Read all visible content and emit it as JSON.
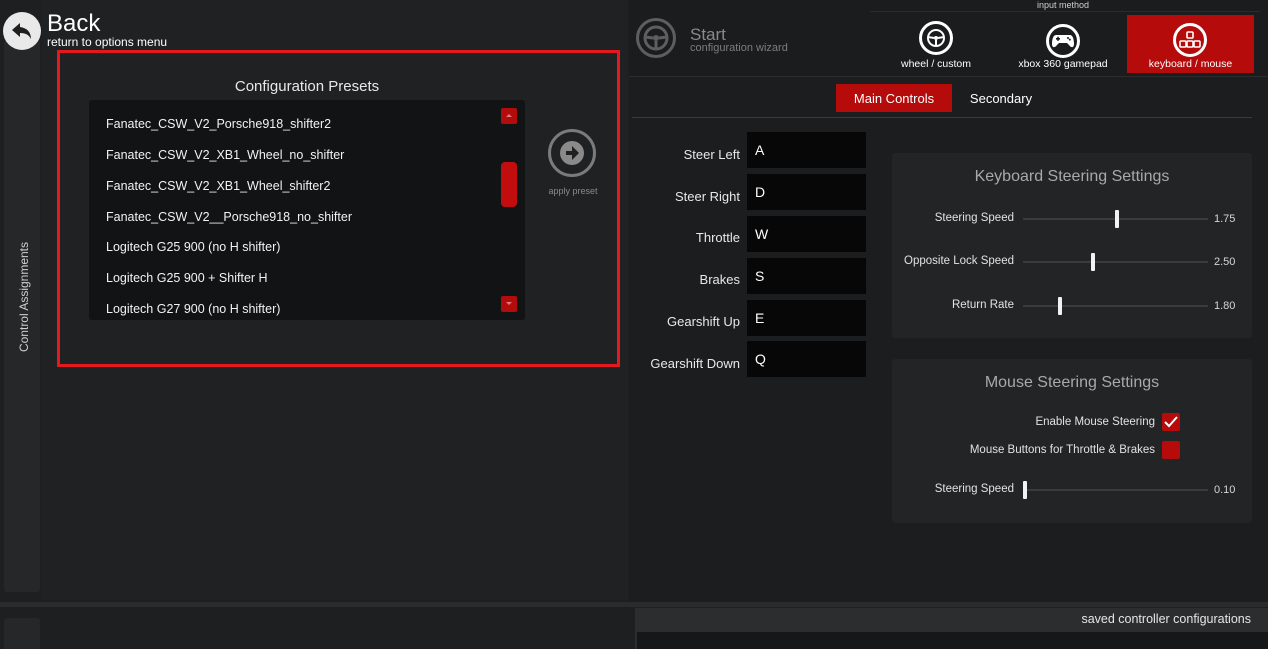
{
  "back": {
    "title": "Back",
    "subtitle": "return to options menu"
  },
  "side_strip": {
    "label": "Control Assignments"
  },
  "presets": {
    "title": "Configuration Presets",
    "items": [
      "Fanatec_CSW_V2_Porsche918_shifter2",
      "Fanatec_CSW_V2_XB1_Wheel_no_shifter",
      "Fanatec_CSW_V2_XB1_Wheel_shifter2",
      "Fanatec_CSW_V2__Porsche918_no_shifter",
      "Logitech G25 900 (no H shifter)",
      "Logitech G25 900 + Shifter H",
      "Logitech G27 900 (no H shifter)"
    ],
    "apply_label": "apply preset"
  },
  "wizard": {
    "title": "Start",
    "subtitle": "configuration wizard"
  },
  "input_method": {
    "label": "input method",
    "options": [
      {
        "label": "wheel / custom",
        "icon": "steering-wheel-icon",
        "selected": false
      },
      {
        "label": "xbox 360 gamepad",
        "icon": "gamepad-icon",
        "selected": false
      },
      {
        "label": "keyboard / mouse",
        "icon": "keyboard-icon",
        "selected": true
      }
    ]
  },
  "tabs": {
    "main": "Main Controls",
    "secondary": "Secondary"
  },
  "bindings": [
    {
      "label": "Steer Left",
      "key": "A"
    },
    {
      "label": "Steer Right",
      "key": "D"
    },
    {
      "label": "Throttle",
      "key": "W"
    },
    {
      "label": "Brakes",
      "key": "S"
    },
    {
      "label": "Gearshift Up",
      "key": "E"
    },
    {
      "label": "Gearshift Down",
      "key": "Q"
    }
  ],
  "keyboard_settings": {
    "title": "Keyboard Steering Settings",
    "sliders": [
      {
        "label": "Steering Speed",
        "value": "1.75",
        "fill": 0.51
      },
      {
        "label": "Opposite Lock Speed",
        "value": "2.50",
        "fill": 0.38
      },
      {
        "label": "Return Rate",
        "value": "1.80",
        "fill": 0.2
      }
    ]
  },
  "mouse_settings": {
    "title": "Mouse Steering Settings",
    "enable_label": "Enable Mouse Steering",
    "enable_checked": true,
    "buttons_label": "Mouse Buttons for Throttle & Brakes",
    "buttons_checked": false,
    "slider": {
      "label": "Steering Speed",
      "value": "0.10",
      "fill": 0.01
    }
  },
  "saved_configs": {
    "label": "saved controller configurations"
  },
  "colors": {
    "accent": "#b50b0b",
    "frame": "#e3191e"
  }
}
